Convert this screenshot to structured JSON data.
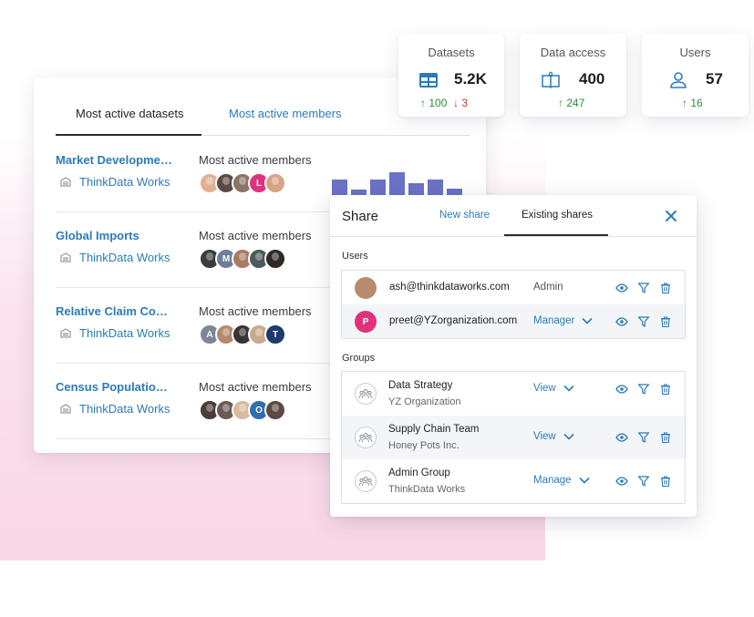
{
  "stats": [
    {
      "title": "Datasets",
      "value": "5.2K",
      "up": "100",
      "down": "3",
      "icon": "table-icon"
    },
    {
      "title": "Data access",
      "value": "400",
      "up": "247",
      "icon": "open-book-icon"
    },
    {
      "title": "Users",
      "value": "57",
      "up": "16",
      "icon": "user-icon"
    }
  ],
  "datasets_panel": {
    "tabs": [
      "Most active datasets",
      "Most active members"
    ],
    "rows": [
      {
        "name": "Market Development...",
        "org": "ThinkData Works",
        "members_label": "Most active members",
        "avatars": [
          "",
          "",
          "",
          "L",
          ""
        ]
      },
      {
        "name": "Global Imports",
        "org": "ThinkData Works",
        "members_label": "Most active members",
        "avatars": [
          "",
          "M",
          "",
          "",
          ""
        ]
      },
      {
        "name": "Relative Claim Costs...",
        "org": "ThinkData Works",
        "members_label": "Most active members",
        "avatars": [
          "A",
          "",
          "",
          "",
          "T"
        ]
      },
      {
        "name": "Census Population D...",
        "org": "ThinkData Works",
        "members_label": "Most active members",
        "avatars": [
          "",
          "",
          "",
          "O",
          ""
        ]
      }
    ],
    "activity_bars": [
      0.7,
      0.3,
      0.7,
      1.0,
      0.55,
      0.7,
      0.35
    ]
  },
  "share": {
    "title": "Share",
    "tabs": [
      "New share",
      "Existing shares"
    ],
    "users_label": "Users",
    "groups_label": "Groups",
    "users": [
      {
        "email": "ash@thinkdataworks.com",
        "role": "Admin",
        "editable": false,
        "avatar": ""
      },
      {
        "email": "preet@YZorganization.com",
        "role": "Manager",
        "editable": true,
        "avatar": "P"
      }
    ],
    "groups": [
      {
        "name": "Data Strategy",
        "org": "YZ Organization",
        "role": "View"
      },
      {
        "name": "Supply Chain Team",
        "org": "Honey Pots Inc.",
        "role": "View"
      },
      {
        "name": "Admin Group",
        "org": "ThinkData Works",
        "role": "Manage"
      }
    ]
  },
  "colors": {
    "link_blue": "#2b7bb9",
    "bar_color": "#6b73c7",
    "up_green": "#2e8b3a",
    "down_red": "#c0392b",
    "preet_avatar": "#e0327a"
  }
}
